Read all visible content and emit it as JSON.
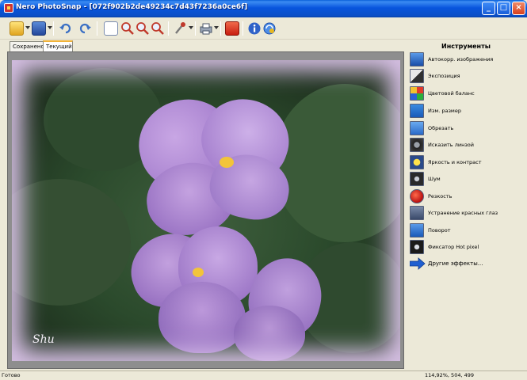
{
  "window": {
    "title": "Nero PhotoSnap - [072f902b2de49234c7d43f7236a0ce6f]",
    "controls": [
      "minimize",
      "maximize",
      "close"
    ]
  },
  "toolbar": {
    "icons": [
      "open-folder-icon",
      "save-icon",
      "undo-icon",
      "redo-icon",
      "zoom-fit-icon",
      "zoom-in-icon",
      "zoom-out-icon",
      "zoom-actual-icon",
      "tools-icon",
      "print-icon",
      "power-icon",
      "info-icon",
      "web-update-icon"
    ]
  },
  "tabs": [
    {
      "label": "Сохранено",
      "active": false
    },
    {
      "label": "Текущий",
      "active": true
    }
  ],
  "photo": {
    "signature": "Shu"
  },
  "tools_panel": {
    "title": "Инструменты",
    "items": [
      {
        "label": "Автокорр. изображения",
        "icon": "auto-correct-icon"
      },
      {
        "label": "Экспозиция",
        "icon": "exposure-icon"
      },
      {
        "label": "Цветовой баланс",
        "icon": "color-balance-icon"
      },
      {
        "label": "Изм. размер",
        "icon": "resize-icon"
      },
      {
        "label": "Обрезать",
        "icon": "crop-icon"
      },
      {
        "label": "Исказить линзой",
        "icon": "lens-distort-icon"
      },
      {
        "label": "Яркость и контраст",
        "icon": "brightness-contrast-icon"
      },
      {
        "label": "Шум",
        "icon": "noise-icon"
      },
      {
        "label": "Резкость",
        "icon": "sharpness-icon"
      },
      {
        "label": "Устранение красных глаз",
        "icon": "red-eye-icon"
      },
      {
        "label": "Поворот",
        "icon": "rotate-icon"
      },
      {
        "label": "Фиксатор Hot pixel",
        "icon": "hot-pixel-icon"
      },
      {
        "label": "Другие эффекты...",
        "icon": "arrow-right-icon"
      }
    ]
  },
  "statusbar": {
    "left": "Готово",
    "right": "114,92%, 504, 499"
  },
  "colors": {
    "title_bar": "#0a4ec6",
    "chrome": "#ece9d8",
    "active_tab_accent": "#f2b338",
    "canvas_bg": "#8e8e8e"
  }
}
